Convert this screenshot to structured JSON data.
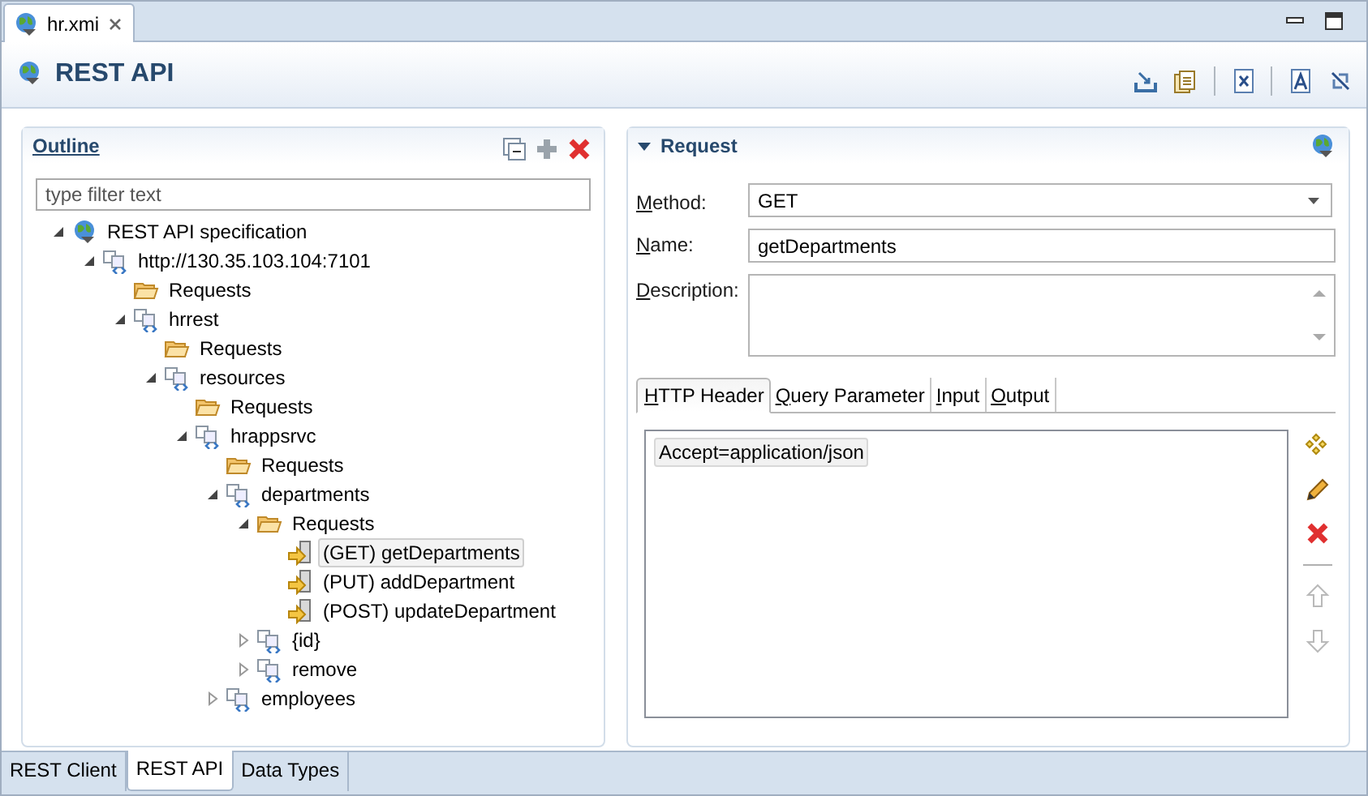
{
  "editor_tab": {
    "title": "hr.xmi"
  },
  "header": {
    "title": "REST API",
    "tools": [
      {
        "kind": "import"
      },
      {
        "kind": "new-doc"
      },
      {
        "kind": "sep"
      },
      {
        "kind": "excel"
      },
      {
        "kind": "sep"
      },
      {
        "kind": "font"
      },
      {
        "kind": "unlink"
      }
    ]
  },
  "outline": {
    "title": "Outline",
    "filter": {
      "placeholder": "type filter text"
    },
    "tree": [
      {
        "label": "REST API specification",
        "kind": "root",
        "expanded": true,
        "selected": false,
        "children": [
          {
            "label": "http://130.35.103.104:7101",
            "kind": "resource",
            "expanded": true,
            "selected": false,
            "children": [
              {
                "label": "Requests",
                "kind": "folder",
                "selected": false
              },
              {
                "label": "hrrest",
                "kind": "resource",
                "expanded": true,
                "selected": false,
                "children": [
                  {
                    "label": "Requests",
                    "kind": "folder",
                    "selected": false
                  },
                  {
                    "label": "resources",
                    "kind": "resource",
                    "expanded": true,
                    "selected": false,
                    "children": [
                      {
                        "label": "Requests",
                        "kind": "folder",
                        "selected": false
                      },
                      {
                        "label": "hrappsrvc",
                        "kind": "resource",
                        "expanded": true,
                        "selected": false,
                        "children": [
                          {
                            "label": "Requests",
                            "kind": "folder",
                            "selected": false
                          },
                          {
                            "label": "departments",
                            "kind": "resource",
                            "expanded": true,
                            "selected": false,
                            "children": [
                              {
                                "label": "Requests",
                                "kind": "folder",
                                "expanded": true,
                                "selected": false,
                                "children": [
                                  {
                                    "label": "(GET) getDepartments",
                                    "kind": "request",
                                    "selected": true
                                  },
                                  {
                                    "label": "(PUT) addDepartment",
                                    "kind": "request",
                                    "selected": false
                                  },
                                  {
                                    "label": "(POST) updateDepartment",
                                    "kind": "request",
                                    "selected": false
                                  }
                                ]
                              },
                              {
                                "label": "{id}",
                                "kind": "resource",
                                "expanded": false,
                                "selected": false
                              },
                              {
                                "label": "remove",
                                "kind": "resource",
                                "expanded": false,
                                "selected": false
                              }
                            ]
                          },
                          {
                            "label": "employees",
                            "kind": "resource",
                            "expanded": false,
                            "selected": false
                          }
                        ]
                      }
                    ]
                  }
                ]
              }
            ]
          }
        ]
      }
    ]
  },
  "request": {
    "title": "Request",
    "expanded": true,
    "fields": [
      {
        "kind": "combo",
        "label": "Method:",
        "value": "GET"
      },
      {
        "kind": "text",
        "label": "Name:",
        "value": "getDepartments"
      },
      {
        "kind": "textarea",
        "label": "Description:"
      }
    ],
    "tabs": [
      {
        "label": "HTTP Header",
        "selected": true
      },
      {
        "label": "Query Parameter",
        "selected": false
      },
      {
        "label": "Input",
        "selected": false
      },
      {
        "label": "Output",
        "selected": false
      }
    ],
    "headers": [
      "Accept=application/json"
    ],
    "side_buttons": [
      {
        "kind": "add",
        "disabled": false
      },
      {
        "kind": "edit",
        "disabled": false
      },
      {
        "kind": "delete",
        "disabled": false
      },
      {
        "kind": "sep"
      },
      {
        "kind": "up",
        "disabled": true
      },
      {
        "kind": "down",
        "disabled": true
      }
    ]
  },
  "bottom_tabs": [
    {
      "label": "REST Client",
      "selected": false
    },
    {
      "label": "REST API",
      "selected": true
    },
    {
      "label": "Data Types",
      "selected": false
    }
  ]
}
